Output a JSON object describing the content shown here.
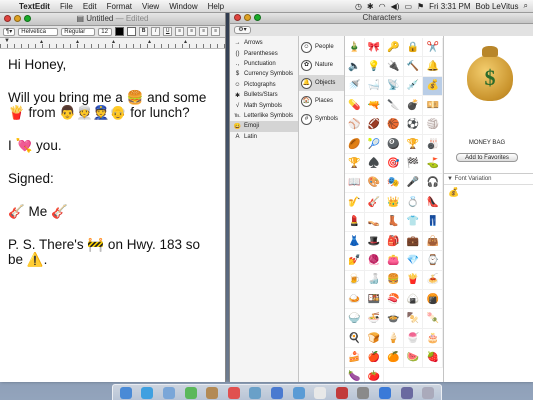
{
  "menubar": {
    "app_name": "TextEdit",
    "items": [
      "File",
      "Edit",
      "Format",
      "View",
      "Window",
      "Help"
    ],
    "clock": "Fri 3:31 PM",
    "user": "Bob LeVitus"
  },
  "textedit": {
    "title": "Untitled",
    "title_suffix": " — Edited",
    "toolbar": {
      "font_family": "Helvetica",
      "font_style": "Regular",
      "font_size": "12"
    },
    "document": {
      "lines": [
        {
          "text": "Hi Honey,"
        },
        {
          "text": "Will you bring me a 🍔 and some 🍟 from 👨👳👮👴 for lunch?"
        },
        {
          "text": "I 💘 you."
        },
        {
          "text": "Signed:"
        },
        {
          "text": "🎸 Me 🎸"
        },
        {
          "text": "P. S. There's 🚧 on Hwy. 183 so be ⚠️."
        }
      ]
    }
  },
  "characters": {
    "title": "Characters",
    "categories": [
      {
        "icon": "→",
        "label": "Arrows"
      },
      {
        "icon": "()",
        "label": "Parentheses"
      },
      {
        "icon": ".,",
        "label": "Punctuation"
      },
      {
        "icon": "$",
        "label": "Currency Symbols"
      },
      {
        "icon": "☺",
        "label": "Pictographs"
      },
      {
        "icon": "✱",
        "label": "Bullets/Stars"
      },
      {
        "icon": "√",
        "label": "Math Symbols"
      },
      {
        "icon": "℡",
        "label": "Letterlike Symbols"
      },
      {
        "icon": "😀",
        "label": "Emoji"
      },
      {
        "icon": "A",
        "label": "Latin"
      }
    ],
    "selected_category": "Emoji",
    "subcategories": [
      {
        "icon": "☺",
        "label": "People"
      },
      {
        "icon": "✿",
        "label": "Nature"
      },
      {
        "icon": "🔔",
        "label": "Objects"
      },
      {
        "icon": "🏠",
        "label": "Places"
      },
      {
        "icon": "#",
        "label": "Symbols"
      }
    ],
    "selected_subcategory": "Objects",
    "grid": [
      "🎍",
      "🎀",
      "🔑",
      "🔒",
      "✂️",
      "🔈",
      "💡",
      "🔌",
      "🔨",
      "🔔",
      "🚿",
      "🛁",
      "📡",
      "💉",
      "💰",
      "💊",
      "🔫",
      "🔪",
      "💣",
      "💴",
      "⚾",
      "🏈",
      "🏀",
      "⚽",
      "🏐",
      "🏉",
      "🎾",
      "🎱",
      "🏆",
      "🎳",
      "🏆",
      "♠️",
      "🎯",
      "🏁",
      "⛳",
      "📖",
      "🎨",
      "🎭",
      "🎤",
      "🎧",
      "🎷",
      "🎸",
      "👑",
      "💍",
      "👠",
      "💄",
      "👡",
      "👢",
      "👕",
      "👖",
      "👗",
      "🎩",
      "🎒",
      "💼",
      "👜",
      "💅",
      "🧶",
      "👛",
      "💎",
      "⌚",
      "🍺",
      "🍶",
      "🍔",
      "🍟",
      "🍝",
      "🍛",
      "🍱",
      "🍣",
      "🍙",
      "🍘",
      "🍚",
      "🍜",
      "🍲",
      "🍢",
      "🍡",
      "🍳",
      "🍞",
      "🍦",
      "🍧",
      "🎂",
      "🍰",
      "🍎",
      "🍊",
      "🍉",
      "🍓",
      "🍆",
      "🍅"
    ],
    "selected_index": 14,
    "selected_name": "MONEY BAG",
    "add_favorites": "Add to Favorites",
    "font_variation_label": "Font Variation",
    "font_variation_glyph": "💰"
  },
  "dock": [
    "Finder",
    "Safari",
    "Mail",
    "iChat",
    "Address Book",
    "iCal",
    "Preview",
    "iTunes",
    "iPhoto",
    "TextEdit",
    "Photo Booth",
    "System Preferences",
    "App Store",
    "Downloads",
    "Trash"
  ]
}
